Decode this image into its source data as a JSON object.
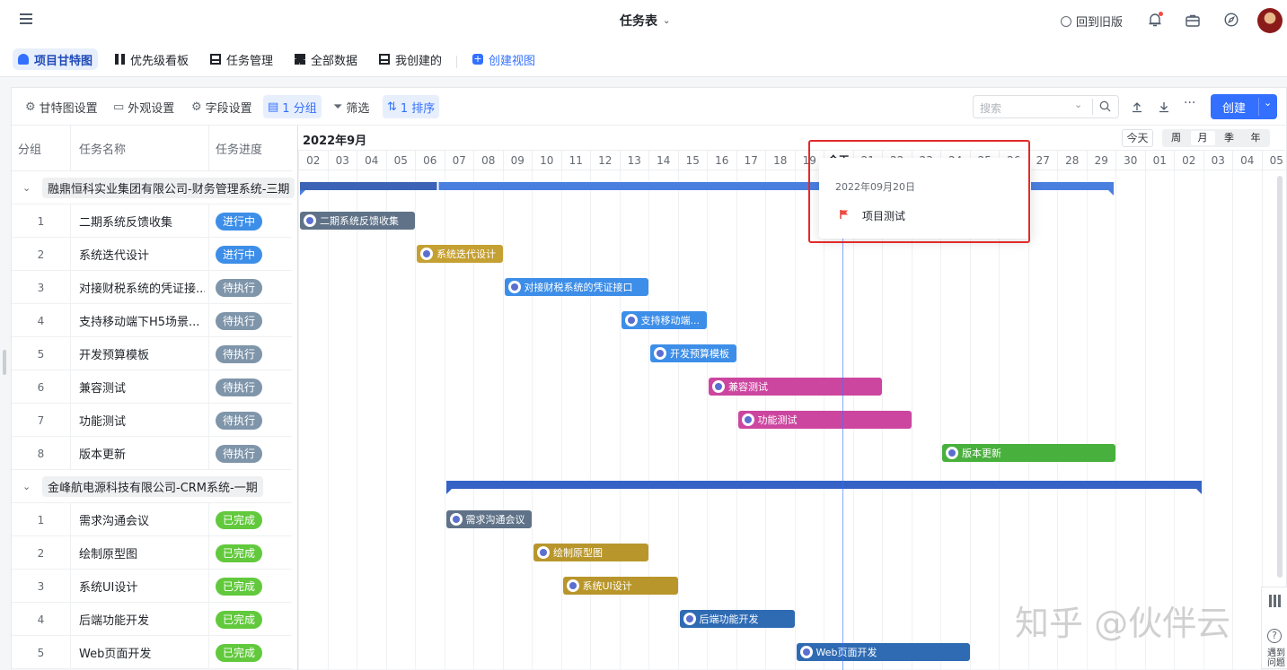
{
  "app": {
    "title": "任务表",
    "back_label": "回到旧版"
  },
  "view_tabs": [
    {
      "label": "项目甘特图",
      "active": true
    },
    {
      "label": "优先级看板"
    },
    {
      "label": "任务管理"
    },
    {
      "label": "全部数据"
    },
    {
      "label": "我创建的"
    },
    {
      "label": "创建视图"
    }
  ],
  "toolbar": {
    "gantt_settings": "甘特图设置",
    "appearance": "外观设置",
    "field_settings": "字段设置",
    "group": "1 分组",
    "filter": "筛选",
    "sort": "1 排序",
    "search_placeholder": "搜索",
    "create": "创建"
  },
  "columns": {
    "group": "分组",
    "name": "任务名称",
    "progress": "任务进度"
  },
  "gantt_header": {
    "month": "2022年9月",
    "today_btn": "今天",
    "scales": [
      "周",
      "月",
      "季",
      "年"
    ],
    "active_scale": "月",
    "days": [
      "02",
      "03",
      "04",
      "05",
      "06",
      "07",
      "08",
      "09",
      "10",
      "11",
      "12",
      "13",
      "14",
      "15",
      "16",
      "17",
      "18",
      "19",
      "今天",
      "21",
      "22",
      "23",
      "24",
      "25",
      "26",
      "27",
      "28",
      "29",
      "30",
      "01",
      "02",
      "03",
      "04",
      "05"
    ],
    "today_index": 18
  },
  "groups": [
    {
      "name": "融鼎恒科实业集团有限公司-财务管理系统-三期",
      "summary": {
        "start": 0,
        "end": 28,
        "color": "#4a7fe0"
      },
      "tasks": [
        {
          "no": "1",
          "name": "二期系统反馈收集",
          "status": "进行中",
          "bar": "二期系统反馈收集",
          "start": 0,
          "end": 4,
          "color": "#5f7288"
        },
        {
          "no": "2",
          "name": "系统迭代设计",
          "status": "进行中",
          "bar": "系统迭代设计",
          "start": 4,
          "end": 7,
          "color": "#c5a032"
        },
        {
          "no": "3",
          "name": "对接财税系统的凭证接...",
          "status": "待执行",
          "bar": "对接财税系统的凭证接口",
          "start": 7,
          "end": 12,
          "color": "#3d8ee8"
        },
        {
          "no": "4",
          "name": "支持移动端下H5场景...",
          "status": "待执行",
          "bar": "支持移动端...",
          "start": 11,
          "end": 14,
          "color": "#3d8ee8"
        },
        {
          "no": "5",
          "name": "开发预算模板",
          "status": "待执行",
          "bar": "开发预算模板",
          "start": 12,
          "end": 15,
          "color": "#3d8ee8"
        },
        {
          "no": "6",
          "name": "兼容测试",
          "status": "待执行",
          "bar": "兼容测试",
          "start": 14,
          "end": 20,
          "color": "#cc46a0"
        },
        {
          "no": "7",
          "name": "功能测试",
          "status": "待执行",
          "bar": "功能测试",
          "start": 15,
          "end": 21,
          "color": "#cc46a0"
        },
        {
          "no": "8",
          "name": "版本更新",
          "status": "待执行",
          "bar": "版本更新",
          "start": 22,
          "end": 28,
          "color": "#48b03c"
        }
      ]
    },
    {
      "name": "金峰航电源科技有限公司-CRM系统-一期",
      "summary": {
        "start": 5,
        "end": 31,
        "color": "#3562c4"
      },
      "tasks": [
        {
          "no": "1",
          "name": "需求沟通会议",
          "status": "已完成",
          "bar": "需求沟通会议",
          "start": 5,
          "end": 8,
          "color": "#5f7288"
        },
        {
          "no": "2",
          "name": "绘制原型图",
          "status": "已完成",
          "bar": "绘制原型图",
          "start": 8,
          "end": 12,
          "color": "#b8962c"
        },
        {
          "no": "3",
          "name": "系统UI设计",
          "status": "已完成",
          "bar": "系统UI设计",
          "start": 9,
          "end": 13,
          "color": "#b8962c"
        },
        {
          "no": "4",
          "name": "后端功能开发",
          "status": "已完成",
          "bar": "后端功能开发",
          "start": 13,
          "end": 17,
          "color": "#2f6bb3"
        },
        {
          "no": "5",
          "name": "Web页面开发",
          "status": "已完成",
          "bar": "Web页面开发",
          "start": 17,
          "end": 23,
          "color": "#2f6bb3"
        }
      ]
    }
  ],
  "status_colors": {
    "进行中": "#3d8ee8",
    "待执行": "#7f95aa",
    "已完成": "#62c93c"
  },
  "popover": {
    "date": "2022年09月20日",
    "item": "项目测试"
  },
  "watermark": "知乎 @伙伴云",
  "side": {
    "help_label": "遇到问题"
  }
}
